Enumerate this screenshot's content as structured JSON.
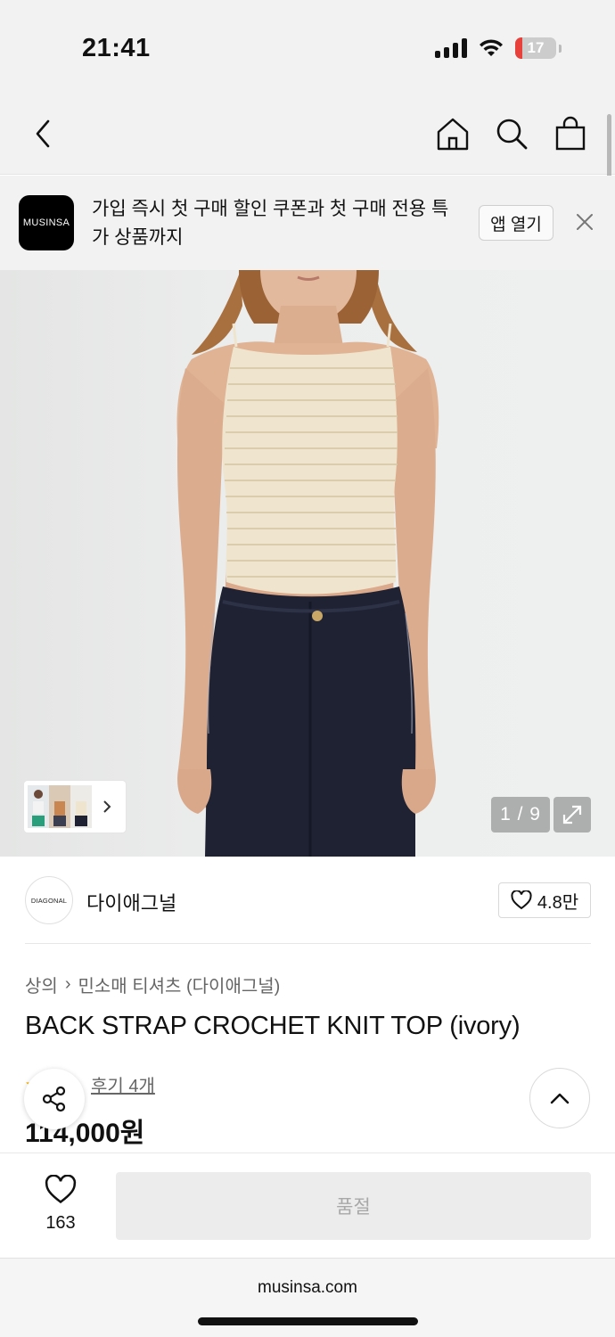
{
  "status_bar": {
    "time": "21:41",
    "battery": "17",
    "battery_level": 0.17
  },
  "promo": {
    "logo_text": "MUSINSA",
    "message": "가입 즉시 첫 구매 할인 쿠폰과 첫 구매 전용 특가 상품까지",
    "open_app_label": "앱 열기"
  },
  "gallery": {
    "counter": "1 / 9"
  },
  "brand": {
    "logo_text": "DIAGONAL",
    "name": "다이애그널",
    "likes": "4.8만"
  },
  "breadcrumb": {
    "category": "상의",
    "separator": "›",
    "subcategory": "민소매 티셔츠 (다이애그널)"
  },
  "product": {
    "title": "BACK STRAP CROCHET KNIT TOP (ivory)",
    "reviews": "후기 4개",
    "price": "114,000원"
  },
  "action_bar": {
    "wish_count": "163",
    "soldout_label": "품절"
  },
  "browser": {
    "url": "musinsa.com"
  },
  "colors": {
    "accent_battery": "#e8403a",
    "background_header": "#f2f2f2",
    "knit_top": "#efe5cf",
    "jeans": "#1f2233"
  }
}
